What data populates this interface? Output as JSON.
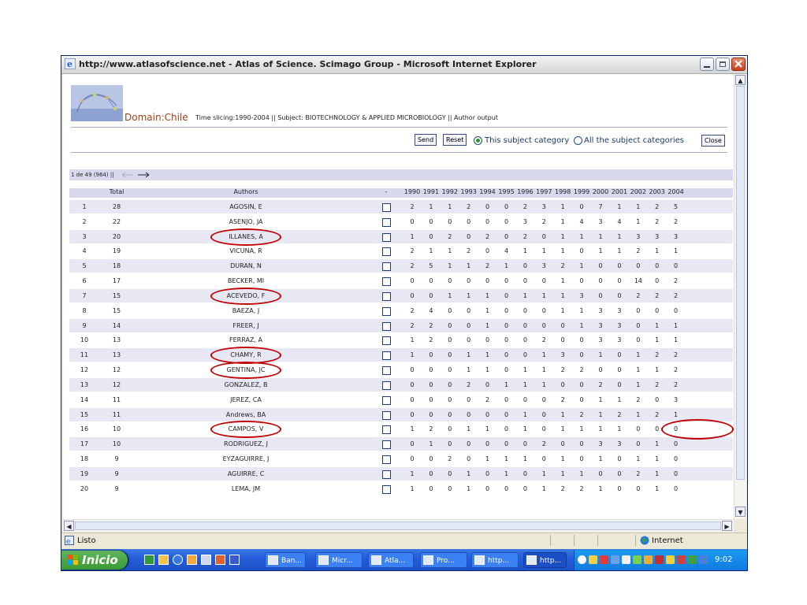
{
  "window": {
    "title": "http://www.atlasofscience.net - Atlas of Science. Scimago Group - Microsoft Internet Explorer"
  },
  "header": {
    "domain": "Domain:Chile",
    "info": "Time slicing:1990-2004 || Subject: BIOTECHNOLOGY & APPLIED MICROBIOLOGY || Author output"
  },
  "controls": {
    "send": "Send",
    "reset": "Reset",
    "radio_this": "This subject category",
    "radio_all": "All the subject categories",
    "close": "Close"
  },
  "pagination": {
    "label": "1 de 49 (964) ||"
  },
  "table": {
    "headers": [
      "",
      "Total",
      "Authors",
      "-",
      "1990",
      "1991",
      "1992",
      "1993",
      "1994",
      "1995",
      "1996",
      "1997",
      "1998",
      "1999",
      "2000",
      "2001",
      "2002",
      "2003",
      "2004"
    ],
    "rows": [
      {
        "n": "1",
        "total": "28",
        "author": "AGOSIN, E",
        "vals": [
          "2",
          "1",
          "1",
          "2",
          "0",
          "0",
          "2",
          "3",
          "1",
          "0",
          "7",
          "1",
          "1",
          "2",
          "5"
        ]
      },
      {
        "n": "2",
        "total": "22",
        "author": "ASENJO, JA",
        "vals": [
          "0",
          "0",
          "0",
          "0",
          "0",
          "0",
          "3",
          "2",
          "1",
          "4",
          "3",
          "4",
          "1",
          "2",
          "2"
        ]
      },
      {
        "n": "3",
        "total": "20",
        "author": "ILLANES, A",
        "vals": [
          "1",
          "0",
          "2",
          "0",
          "2",
          "0",
          "2",
          "0",
          "1",
          "1",
          "1",
          "1",
          "3",
          "3",
          "3"
        ]
      },
      {
        "n": "4",
        "total": "19",
        "author": "VICUNA, R",
        "vals": [
          "2",
          "1",
          "1",
          "2",
          "0",
          "4",
          "1",
          "1",
          "1",
          "0",
          "1",
          "1",
          "2",
          "1",
          "1"
        ]
      },
      {
        "n": "5",
        "total": "18",
        "author": "DURAN, N",
        "vals": [
          "2",
          "5",
          "1",
          "1",
          "2",
          "1",
          "0",
          "3",
          "2",
          "1",
          "0",
          "0",
          "0",
          "0",
          "0"
        ]
      },
      {
        "n": "6",
        "total": "17",
        "author": "BECKER, MI",
        "vals": [
          "0",
          "0",
          "0",
          "0",
          "0",
          "0",
          "0",
          "0",
          "1",
          "0",
          "0",
          "0",
          "14",
          "0",
          "2"
        ]
      },
      {
        "n": "7",
        "total": "15",
        "author": "ACEVEDO, F",
        "vals": [
          "0",
          "0",
          "1",
          "1",
          "1",
          "0",
          "1",
          "1",
          "1",
          "3",
          "0",
          "0",
          "2",
          "2",
          "2"
        ]
      },
      {
        "n": "8",
        "total": "15",
        "author": "BAEZA, J",
        "vals": [
          "2",
          "4",
          "0",
          "0",
          "1",
          "0",
          "0",
          "0",
          "1",
          "1",
          "3",
          "3",
          "0",
          "0",
          "0"
        ]
      },
      {
        "n": "9",
        "total": "14",
        "author": "FREER, J",
        "vals": [
          "2",
          "2",
          "0",
          "0",
          "1",
          "0",
          "0",
          "0",
          "0",
          "1",
          "3",
          "3",
          "0",
          "1",
          "1"
        ]
      },
      {
        "n": "10",
        "total": "13",
        "author": "FERRAZ, A",
        "vals": [
          "1",
          "2",
          "0",
          "0",
          "0",
          "0",
          "0",
          "2",
          "0",
          "0",
          "3",
          "3",
          "0",
          "1",
          "1"
        ]
      },
      {
        "n": "11",
        "total": "13",
        "author": "CHAMY, R",
        "vals": [
          "1",
          "0",
          "0",
          "1",
          "1",
          "0",
          "0",
          "1",
          "3",
          "0",
          "1",
          "0",
          "1",
          "2",
          "2"
        ]
      },
      {
        "n": "12",
        "total": "12",
        "author": "GENTINA, JC",
        "vals": [
          "0",
          "0",
          "0",
          "1",
          "1",
          "0",
          "1",
          "1",
          "2",
          "2",
          "0",
          "0",
          "1",
          "1",
          "2"
        ]
      },
      {
        "n": "13",
        "total": "12",
        "author": "GONZALEZ, B",
        "vals": [
          "0",
          "0",
          "0",
          "2",
          "0",
          "1",
          "1",
          "1",
          "0",
          "0",
          "2",
          "0",
          "1",
          "2",
          "2"
        ]
      },
      {
        "n": "14",
        "total": "11",
        "author": "JEREZ, CA",
        "vals": [
          "0",
          "0",
          "0",
          "0",
          "2",
          "0",
          "0",
          "0",
          "2",
          "0",
          "1",
          "1",
          "2",
          "0",
          "3"
        ]
      },
      {
        "n": "15",
        "total": "11",
        "author": "Andrews, BA",
        "vals": [
          "0",
          "0",
          "0",
          "0",
          "0",
          "0",
          "1",
          "0",
          "1",
          "2",
          "1",
          "2",
          "1",
          "2",
          "1"
        ]
      },
      {
        "n": "16",
        "total": "10",
        "author": "CAMPOS, V",
        "vals": [
          "1",
          "2",
          "0",
          "1",
          "1",
          "0",
          "1",
          "0",
          "1",
          "1",
          "1",
          "1",
          "0",
          "0",
          "0"
        ]
      },
      {
        "n": "17",
        "total": "10",
        "author": "RODRIGUEZ, J",
        "vals": [
          "0",
          "1",
          "0",
          "0",
          "0",
          "0",
          "0",
          "2",
          "0",
          "0",
          "3",
          "3",
          "0",
          "1",
          "0"
        ]
      },
      {
        "n": "18",
        "total": "9",
        "author": "EYZAGUIRRE, J",
        "vals": [
          "0",
          "0",
          "2",
          "0",
          "1",
          "1",
          "1",
          "0",
          "1",
          "0",
          "1",
          "0",
          "1",
          "1",
          "0"
        ]
      },
      {
        "n": "19",
        "total": "9",
        "author": "AGUIRRE, C",
        "vals": [
          "1",
          "0",
          "0",
          "1",
          "0",
          "1",
          "0",
          "1",
          "1",
          "1",
          "0",
          "0",
          "2",
          "1",
          "0"
        ]
      },
      {
        "n": "20",
        "total": "9",
        "author": "LEMA, JM",
        "vals": [
          "1",
          "0",
          "0",
          "1",
          "0",
          "0",
          "0",
          "1",
          "2",
          "2",
          "1",
          "0",
          "0",
          "1",
          "0"
        ]
      }
    ]
  },
  "statusbar": {
    "left": "Listo",
    "zone": "Internet"
  },
  "taskbar": {
    "start": "Inicio",
    "tasks": [
      "Ban...",
      "Micr...",
      "Atla...",
      "Pro...",
      "http...",
      "http..."
    ],
    "clock": "9:02"
  },
  "colors": {
    "annotation_red": "#c00000",
    "row_band": "#e8e8f4",
    "header_band": "#d8d8ee",
    "domain_text": "#a0401a"
  }
}
